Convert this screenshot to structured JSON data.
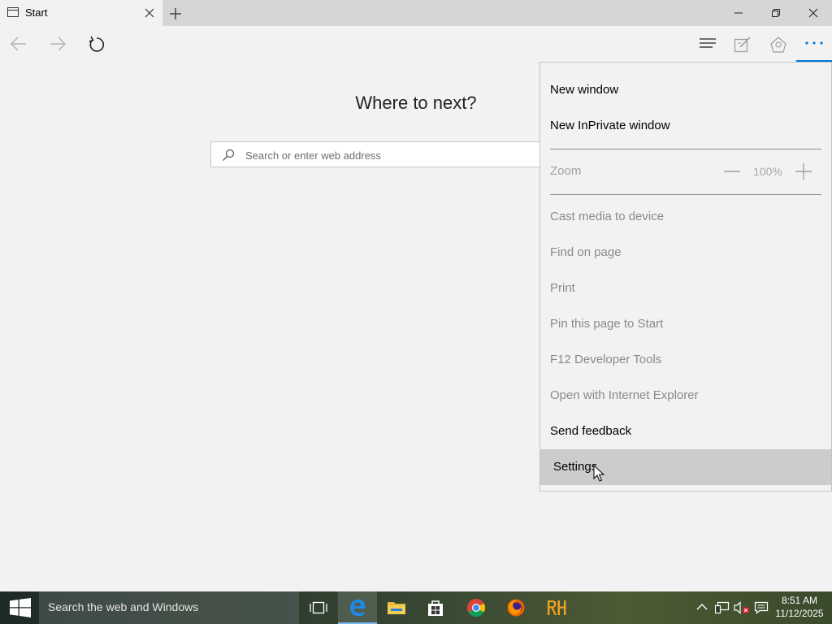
{
  "tab": {
    "title": "Start"
  },
  "page": {
    "heading": "Where to next?",
    "search_placeholder": "Search or enter web address"
  },
  "menu": {
    "new_window": "New window",
    "new_inprivate": "New InPrivate window",
    "zoom_label": "Zoom",
    "zoom_value": "100%",
    "cast": "Cast media to device",
    "find": "Find on page",
    "print": "Print",
    "pin": "Pin this page to Start",
    "devtools": "F12 Developer Tools",
    "open_ie": "Open with Internet Explorer",
    "feedback": "Send feedback",
    "settings": "Settings"
  },
  "taskbar": {
    "search_text": "Search the web and Windows",
    "time": "8:51 AM",
    "date": "11/12/2025",
    "apps": [
      "task-view-icon",
      "edge-icon",
      "file-explorer-icon",
      "store-icon",
      "chrome-icon",
      "firefox-icon",
      "rh-app-icon"
    ]
  },
  "colors": {
    "accent": "#0078d7",
    "menu_hover": "#cccccc",
    "disabled_text": "#8a8a8a"
  }
}
